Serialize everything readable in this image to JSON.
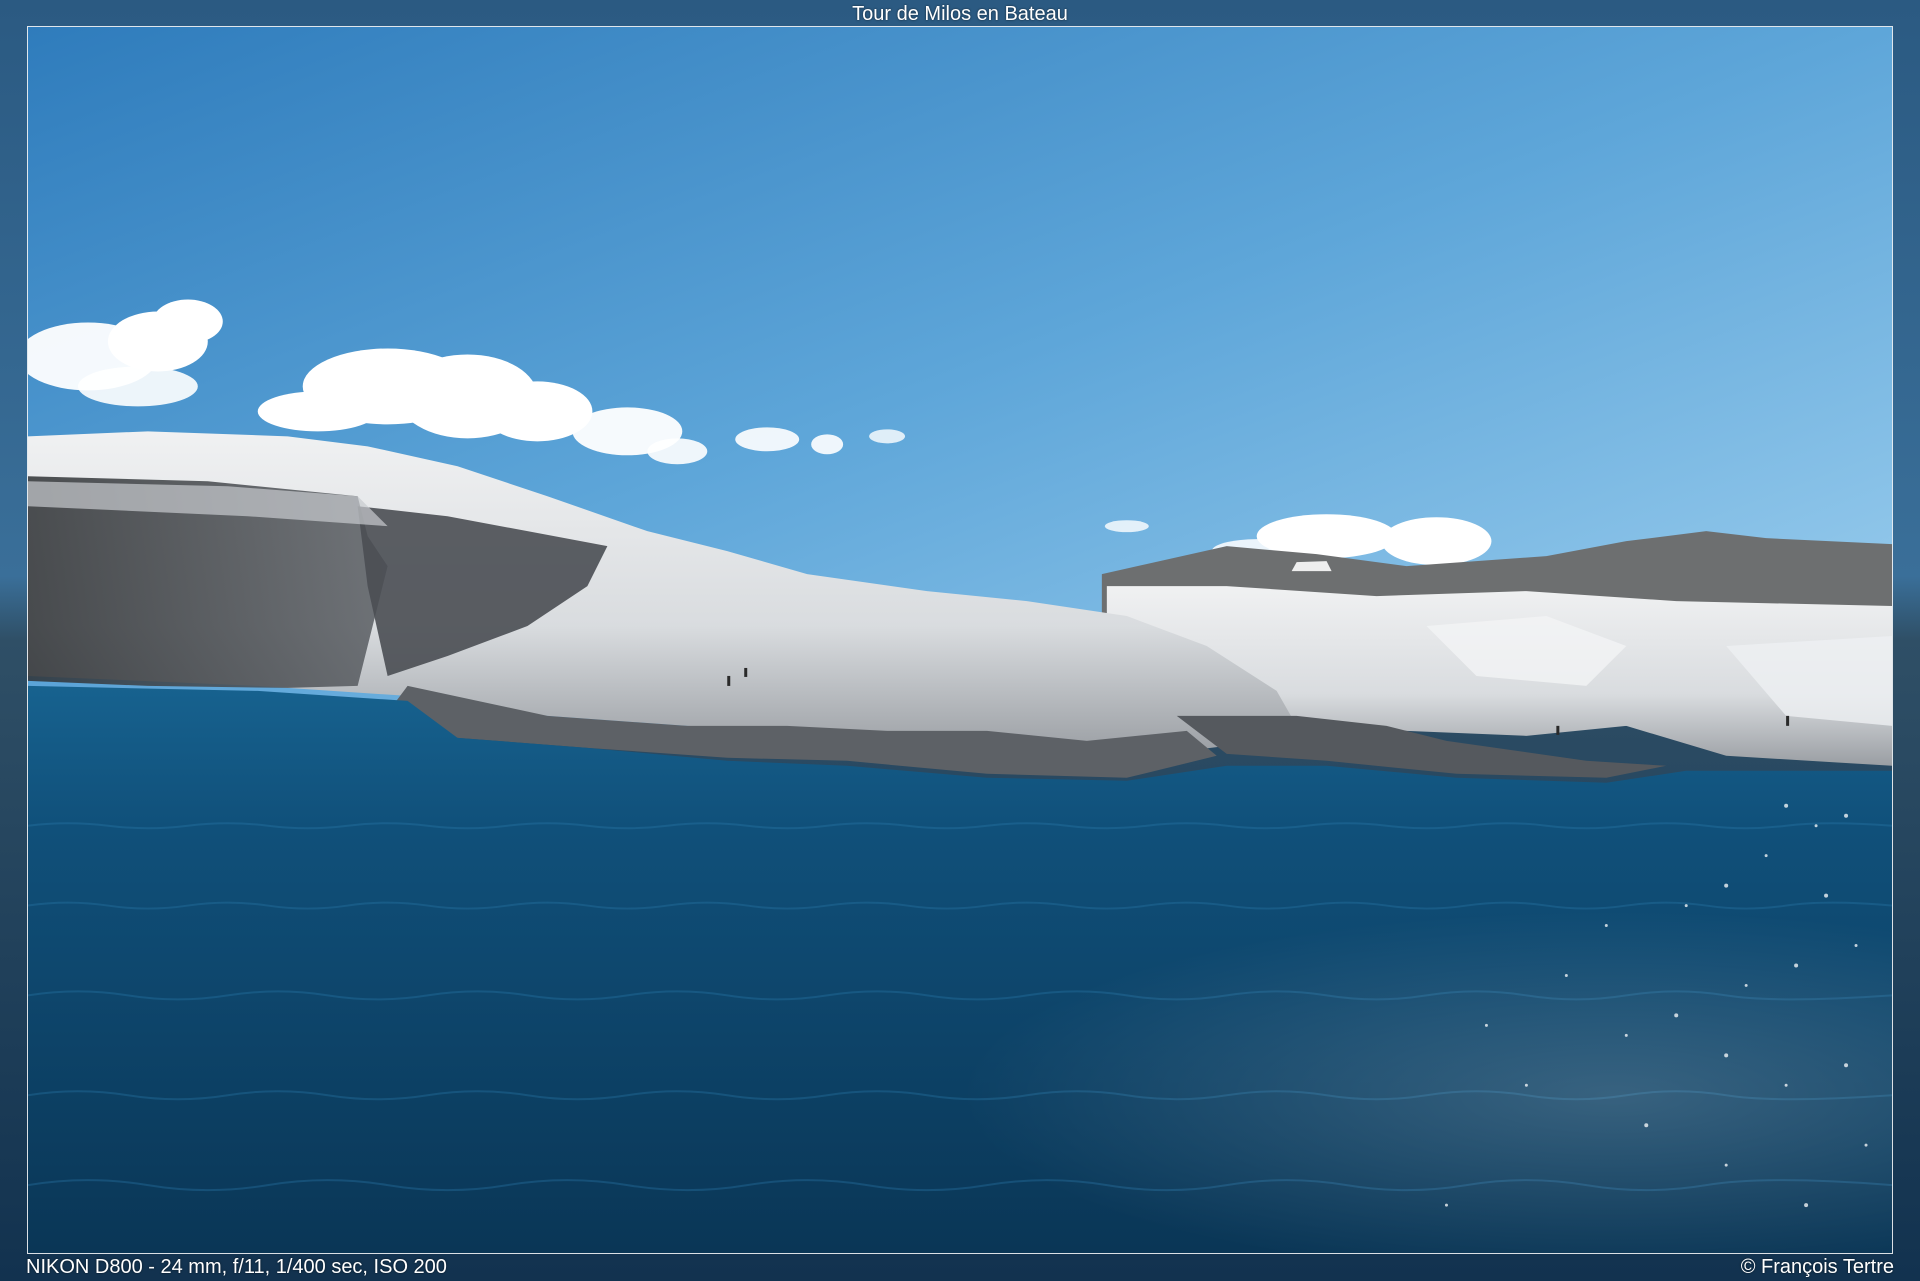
{
  "viewer": {
    "title": "Tour de Milos en Bateau",
    "exif": "NIKON D800 - 24 mm, f/11, 1/400 sec, ISO 200",
    "credit": "© François Tertre"
  },
  "photo": {
    "scene": [
      "blue-sky",
      "white-clouds",
      "white-rock-cliffs",
      "deep-blue-sea",
      "sun-glitter"
    ],
    "colors": {
      "sky_top": "#3b86c4",
      "sky_bottom": "#8cc4e8",
      "sea_deep": "#0c3a5c",
      "sea_mid": "#155a86",
      "rock_light": "#e6e8ea",
      "rock_shadow": "#6f7278"
    }
  }
}
